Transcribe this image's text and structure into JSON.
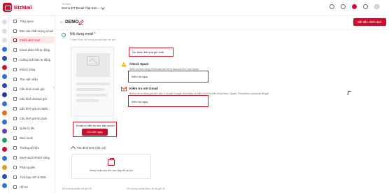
{
  "app": {
    "name": "BizMail"
  },
  "org": {
    "label": "Tổ chức",
    "value": "Demo ĐT Email Tập tran..."
  },
  "sidebar": {
    "items": [
      {
        "label": "Tổng quan"
      },
      {
        "label": "Báo cáo chất lượng email"
      },
      {
        "label": "Chiến dịch mail"
      },
      {
        "label": "Email phản hồi tự động"
      },
      {
        "label": "Luồng kịch bản tự động"
      },
      {
        "label": "Khách hàng"
      },
      {
        "label": "Thư viện mẫu"
      },
      {
        "label": "Cấu hình email gửi"
      },
      {
        "label": "Cấu hình domain gửi"
      },
      {
        "label": "Cấu hình gửi tin SMS"
      },
      {
        "label": "Cấu hình gửi tin Zalo"
      },
      {
        "label": "Quản lý file"
      },
      {
        "label": "Web hook"
      },
      {
        "label": "Trường dữ liệu"
      },
      {
        "label": "Danh sách khách hàng"
      },
      {
        "label": "Phân quyền"
      },
      {
        "label": "Tích hợp API & SDK"
      },
      {
        "label": "Hỗ trợ"
      }
    ],
    "active_index": 2
  },
  "header": {
    "title": "DEMO",
    "start_button": "Bắt đầu chiến dịch"
  },
  "content": {
    "section_title": "Nội dung email *",
    "section_subtitle": "Chỉnh sửa nội dung email bạn sẽ gửi",
    "result_button": "Dự đoán kết quả gửi mail",
    "spam": {
      "title": "Check Spam",
      "desc": "Kiểm tra khả năng email của bạn sẽ bị đưa vào thư mục spam",
      "button": "Kiểm tra ngay"
    },
    "gmail": {
      "title": "Kiểm tra với Gmail",
      "desc": "BizFly sẽ tự động gửi thử đến 13 email Google của Bizfly và kiểm tra tỉ lệ hiển thị ở Inbox, Spam, Promotion của email đã gửi",
      "button": "Kiểm tra ngay"
    },
    "test": {
      "question": "Email có hiển thị như bạn muốn?",
      "button": "Gửi thử ngay"
    },
    "attach": {
      "label": "File đính kèm (nếu có)",
      "dropzone": "Nhấn hoặc kéo file vào đây để tải lên"
    },
    "footer_left": "Số lượng email sẽ gửi đi",
    "footer_right": "Số lượng email thực tế sẽ gửi đi"
  }
}
